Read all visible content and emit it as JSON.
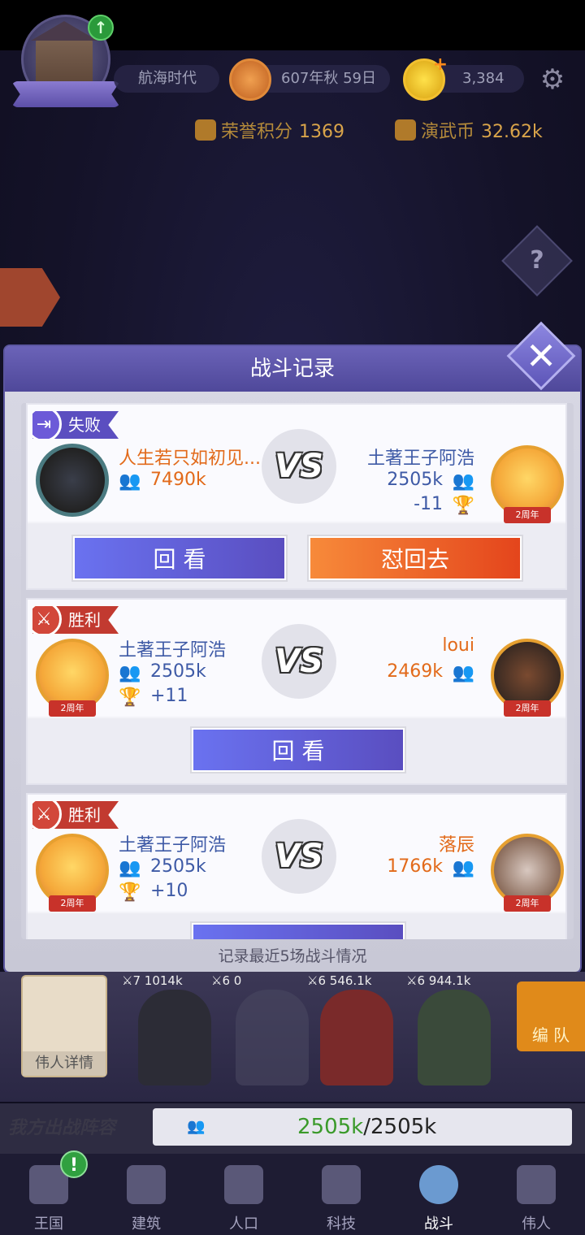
{
  "hud": {
    "era": "航海时代",
    "date": "607年秋 59日",
    "gold": "3,384",
    "honor_label": "荣誉积分",
    "honor_value": "1369",
    "coin_label": "演武币",
    "coin_value": "32.62k"
  },
  "dialog": {
    "title": "战斗记录",
    "footer": "记录最近5场战斗情况",
    "vs_label": "VS",
    "records": [
      {
        "result": "失败",
        "left_name": "人生若只如初见...",
        "left_power": "7490k",
        "right_name": "土著王子阿浩",
        "right_power": "2505k",
        "trophy_change": "-11",
        "buttons": [
          "回 看",
          "怼回去"
        ]
      },
      {
        "result": "胜利",
        "left_name": "土著王子阿浩",
        "left_power": "2505k",
        "trophy_change": "+11",
        "right_name": "loui",
        "right_power": "2469k",
        "buttons": [
          "回 看"
        ]
      },
      {
        "result": "胜利",
        "left_name": "土著王子阿浩",
        "left_power": "2505k",
        "trophy_change": "+10",
        "right_name": "落辰",
        "right_power": "1766k",
        "buttons": []
      }
    ]
  },
  "heroes": {
    "great_person_label": "伟人详情",
    "slots": [
      {
        "level": "7",
        "power": "1014k"
      },
      {
        "level": "6",
        "power": "0"
      },
      {
        "level": "6",
        "power": "546.1k"
      },
      {
        "level": "6",
        "power": "944.1k"
      }
    ],
    "formation_label": "编 队"
  },
  "lineup": {
    "label": "我方出战阵容",
    "current": "2505k",
    "max": "/2505k"
  },
  "nav": {
    "items": [
      "王国",
      "建筑",
      "人口",
      "科技",
      "战斗",
      "伟人"
    ],
    "badge": "!"
  }
}
